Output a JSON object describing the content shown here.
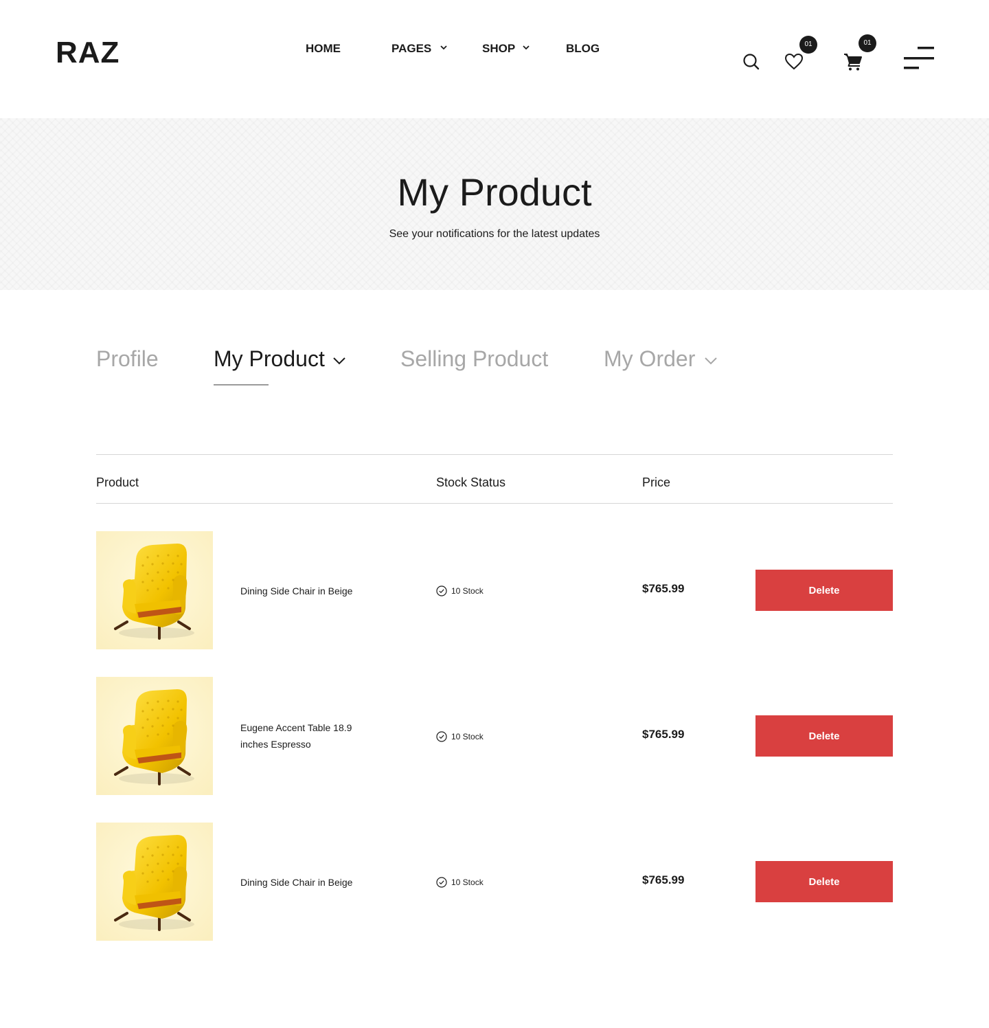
{
  "header": {
    "logo": "RAZ",
    "nav": [
      {
        "label": "HOME",
        "has_dropdown": false
      },
      {
        "label": "PAGES",
        "has_dropdown": true
      },
      {
        "label": "SHOP",
        "has_dropdown": true
      },
      {
        "label": "BLOG",
        "has_dropdown": false
      }
    ],
    "wishlist_count": "01",
    "cart_count": "01",
    "icons": [
      "search-icon",
      "heart-icon",
      "cart-icon",
      "menu-icon"
    ]
  },
  "banner": {
    "title": "My Product",
    "subtitle": "See your notifications for the latest updates"
  },
  "tabs": [
    {
      "label": "Profile",
      "active": false,
      "has_dropdown": false
    },
    {
      "label": "My Product",
      "active": true,
      "has_dropdown": true
    },
    {
      "label": "Selling Product",
      "active": false,
      "has_dropdown": false
    },
    {
      "label": "My Order",
      "active": false,
      "has_dropdown": true
    }
  ],
  "table": {
    "headers": {
      "product": "Product",
      "stock": "Stock Status",
      "price": "Price"
    },
    "rows": [
      {
        "name": "Dining Side Chair in Beige",
        "stock": "10 Stock",
        "price": "$765.99",
        "action": "Delete"
      },
      {
        "name": "Eugene Accent Table 18.9 inches Espresso",
        "stock": "10 Stock",
        "price": "$765.99",
        "action": "Delete"
      },
      {
        "name": "Dining Side Chair in Beige",
        "stock": "10 Stock",
        "price": "$765.99",
        "action": "Delete"
      }
    ]
  },
  "colors": {
    "text": "#1b1b1b",
    "muted_tab": "#a7a7a7",
    "delete_button": "#d94040",
    "banner_bg": "#f7f7f7",
    "chair_yellow": "#f2c200"
  }
}
